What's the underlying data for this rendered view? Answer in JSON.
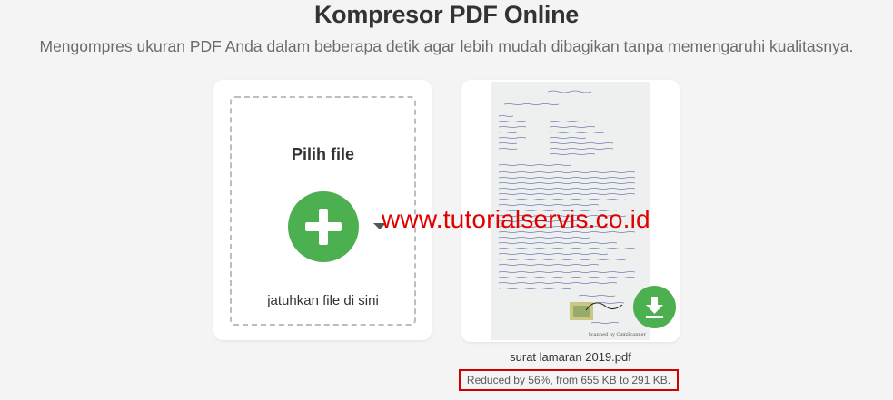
{
  "header": {
    "title": "Kompresor PDF Online",
    "subtitle": "Mengompres ukuran PDF Anda dalam beberapa detik agar lebih mudah dibagikan tanpa memengaruhi kualitasnya."
  },
  "upload": {
    "pick_label": "Pilih file",
    "drop_label": "jatuhkan file di sini",
    "add_icon": "plus-icon",
    "menu_icon": "caret-down-icon"
  },
  "result": {
    "file_name": "surat lamaran 2019.pdf",
    "reduce_text": "Reduced by 56%, from 655 KB to 291 KB.",
    "download_icon": "download-icon",
    "scan_caption": "Scanned by CamScanner"
  },
  "watermark": "www.tutorialservis.co.id",
  "colors": {
    "accent_green": "#4caf50",
    "highlight_red": "#d00000",
    "watermark_red": "#e00000"
  }
}
